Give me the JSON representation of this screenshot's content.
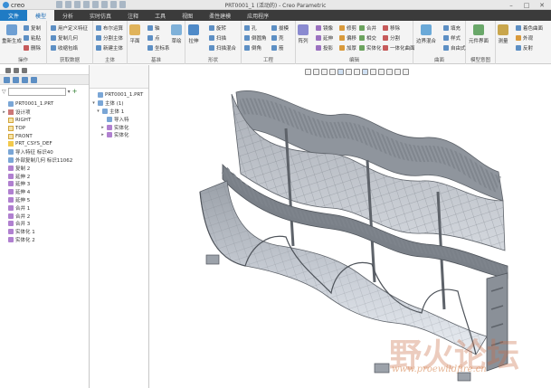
{
  "app": {
    "logo_text": "creo",
    "window_title": "PRT0001_1 (活动的) - Creo Parametric",
    "minimize": "–",
    "maximize": "□",
    "close": "✕"
  },
  "menu": {
    "tabs": [
      {
        "label": "文件"
      },
      {
        "label": "模型"
      },
      {
        "label": "分析"
      },
      {
        "label": "实时仿真"
      },
      {
        "label": "注释"
      },
      {
        "label": "工具"
      },
      {
        "label": "视图"
      },
      {
        "label": "柔性建模"
      },
      {
        "label": "应用程序"
      }
    ]
  },
  "ribbon": {
    "groups": {
      "ops": {
        "label": "操作",
        "big": "重新生成",
        "items": [
          "复制",
          "粘贴",
          "删除"
        ]
      },
      "get": {
        "label": "获取数据",
        "items": [
          "用户定义特征",
          "复制几何",
          "收缩包络"
        ]
      },
      "body": {
        "label": "主体",
        "items": [
          "布尔运算",
          "分割主体",
          "新建主体"
        ]
      },
      "datum": {
        "label": "基准",
        "big1": "平面",
        "items": [
          "轴",
          "点",
          "坐标系"
        ],
        "big2": "草绘"
      },
      "shapes": {
        "label": "形状",
        "big": "拉伸",
        "items": [
          "旋转",
          "扫描",
          "扫描混合"
        ]
      },
      "eng": {
        "label": "工程",
        "items": [
          "孔",
          "倒圆角",
          "倒角",
          "拔模",
          "壳",
          "筋"
        ]
      },
      "edit": {
        "label": "编辑",
        "big": "阵列",
        "items": [
          "镜像",
          "延伸",
          "投影",
          "修剪",
          "偏移",
          "加厚",
          "合并",
          "相交",
          "实体化",
          "移除",
          "分割",
          "一体化曲面"
        ]
      },
      "surf": {
        "label": "曲面",
        "big": "边界混合",
        "items": [
          "填充",
          "样式",
          "自由式"
        ]
      },
      "intent": {
        "label": "模型意图",
        "big": "元件界面"
      },
      "more": {
        "label": "",
        "big": "测量",
        "items": [
          "着色曲面",
          "外观",
          "反射"
        ]
      }
    }
  },
  "left_panel": {
    "search_placeholder": "",
    "tree": [
      {
        "label": "PRT0001_1.PRT",
        "icon": "part-icon"
      },
      {
        "label": "设计项",
        "icon": "folder-icon"
      },
      {
        "label": "RIGHT",
        "icon": "plane-icon"
      },
      {
        "label": "TOP",
        "icon": "plane-icon"
      },
      {
        "label": "FRONT",
        "icon": "plane-icon"
      },
      {
        "label": "PRT_CSYS_DEF",
        "icon": "csys-icon"
      },
      {
        "label": "导入特征 标识40",
        "icon": "import-icon"
      },
      {
        "label": "外部复制几何 标识11062",
        "icon": "copy-geometry-icon"
      },
      {
        "label": "复制 2",
        "icon": "copy-icon"
      },
      {
        "label": "延伸 2",
        "icon": "extend-icon"
      },
      {
        "label": "延伸 3",
        "icon": "extend-icon"
      },
      {
        "label": "延伸 4",
        "icon": "extend-icon"
      },
      {
        "label": "延伸 5",
        "icon": "extend-icon"
      },
      {
        "label": "合并 1",
        "icon": "merge-icon"
      },
      {
        "label": "合并 2",
        "icon": "merge-icon"
      },
      {
        "label": "合并 3",
        "icon": "merge-icon"
      },
      {
        "label": "实体化 1",
        "icon": "solidify-icon"
      },
      {
        "label": "实体化 2",
        "icon": "solidify-icon"
      }
    ]
  },
  "mid_panel": {
    "tree": [
      {
        "label": "PRT0001_1.PRT"
      },
      {
        "label": "主体 (1)"
      },
      {
        "label": "主体 1"
      },
      {
        "label": "导入特"
      },
      {
        "label": "实体化"
      },
      {
        "label": "实体化"
      }
    ]
  },
  "watermark": {
    "main": "野火论坛",
    "sub": "www.proewildfire.cn"
  }
}
